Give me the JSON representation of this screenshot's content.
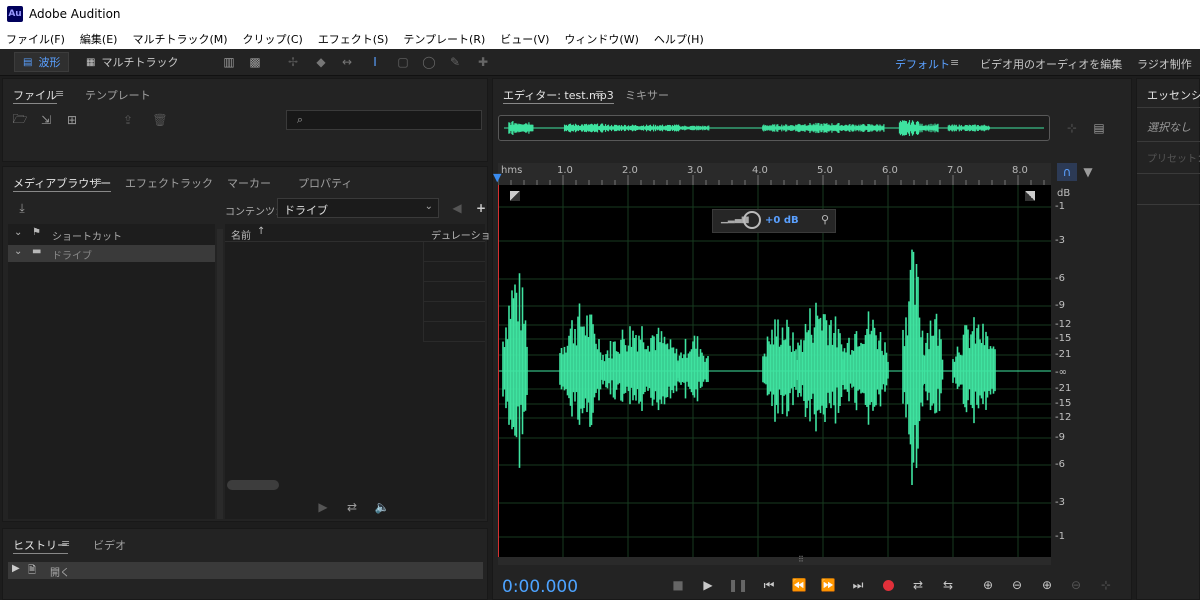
{
  "app": {
    "logo": "Au",
    "title": "Adobe Audition"
  },
  "menu": [
    "ファイル(F)",
    "編集(E)",
    "マルチトラック(M)",
    "クリップ(C)",
    "エフェクト(S)",
    "テンプレート(R)",
    "ビュー(V)",
    "ウィンドウ(W)",
    "ヘルプ(H)"
  ],
  "toolbar": {
    "waveform_label": "波形",
    "multitrack_label": "マルチトラック",
    "workspaces": {
      "default": "デフォルト",
      "video_audio": "ビデオ用のオーディオを編集",
      "radio": "ラジオ制作"
    }
  },
  "files_panel": {
    "tab_files": "ファイル",
    "tab_template": "テンプレート"
  },
  "media_browser": {
    "tabs": [
      "メディアブラウザー",
      "エフェクトラック",
      "マーカー",
      "プロパティ"
    ],
    "content_label": "コンテンツ：",
    "content_value": "ドライブ",
    "tree": [
      "ショートカット",
      "ドライブ"
    ],
    "columns": {
      "name": "名前",
      "duration": "デュレーション"
    }
  },
  "history_panel": {
    "tab_history": "ヒストリー",
    "tab_video": "ビデオ",
    "items": [
      "開く"
    ]
  },
  "editor": {
    "tab_editor": "エディター: test.mp3",
    "tab_mixer": "ミキサー",
    "hud_gain": "+0 dB",
    "time_display": "0:00.000",
    "ruler_unit": "hms",
    "ruler_ticks": [
      "1.0",
      "2.0",
      "3.0",
      "4.0",
      "5.0",
      "6.0",
      "7.0",
      "8.0"
    ],
    "db_unit": "dB",
    "db_ticks": [
      "-1",
      "-3",
      "-6",
      "-9",
      "-12",
      "-15",
      "-21",
      "-∞",
      "-21",
      "-15",
      "-12",
      "-9",
      "-6",
      "-3",
      "-1"
    ]
  },
  "essential_panel": {
    "title": "エッセンシャル",
    "no_selection": "選択なし",
    "preset": "プリセット："
  },
  "colors": {
    "accent": "#5aa0ff",
    "waveform": "#3fe3a0",
    "playhead": "#d53030",
    "record": "#e0303a"
  },
  "icons": [
    "folder-open-icon",
    "import-icon",
    "new-file-icon",
    "export-icon",
    "trash-icon",
    "search-icon",
    "download-icon",
    "back-icon",
    "add-icon",
    "play-icon",
    "loop-icon",
    "autoplay-icon",
    "stop-icon",
    "pause-icon",
    "skip-start-icon",
    "rewind-icon",
    "fast-forward-icon",
    "skip-end-icon",
    "record-icon",
    "skip-icon",
    "zoom-in-icon",
    "zoom-out-icon",
    "pin-icon",
    "snap-icon",
    "marker-icon"
  ]
}
